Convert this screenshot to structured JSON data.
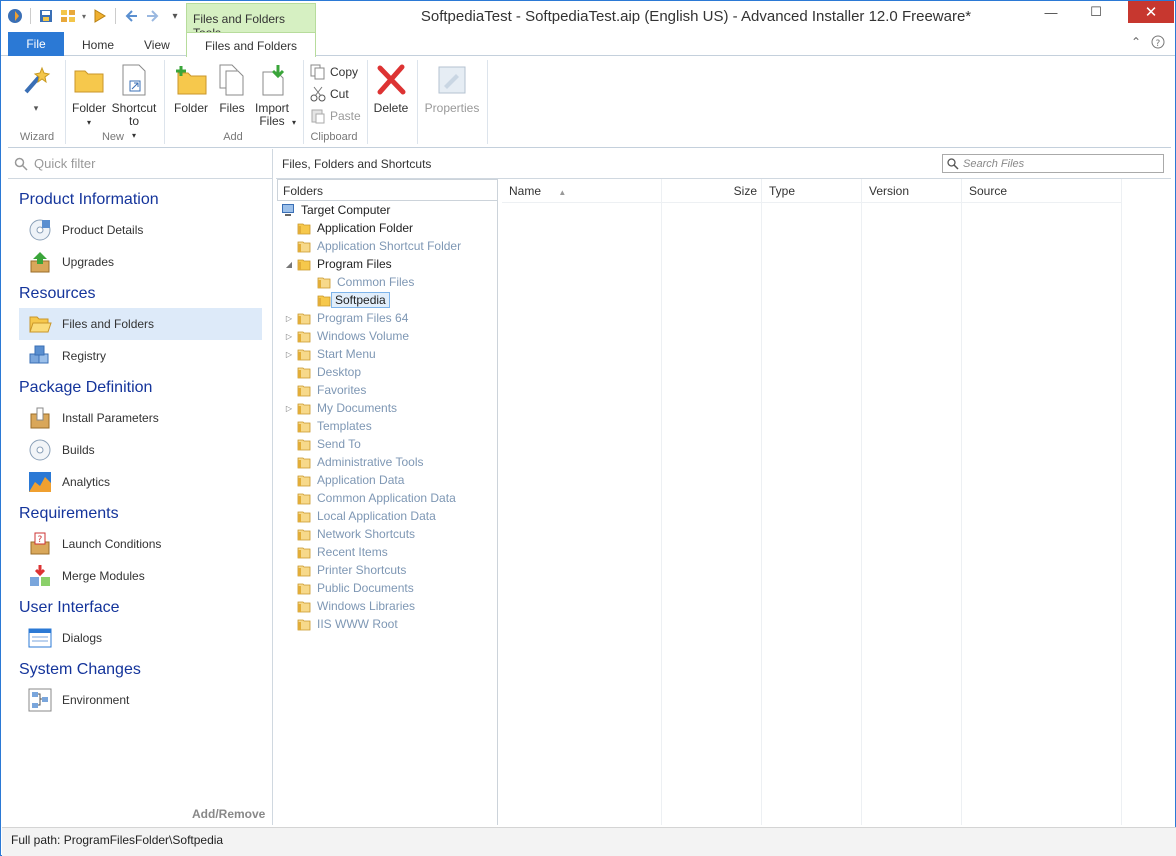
{
  "window": {
    "title": "SoftpediaTest - SoftpediaTest.aip (English US) - Advanced Installer 12.0 Freeware*",
    "context_tab": "Files and Folders Tools",
    "minimize": "—",
    "maximize": "☐",
    "close": "✕"
  },
  "tabs": {
    "file": "File",
    "home": "Home",
    "view": "View",
    "files_and_folders": "Files and Folders"
  },
  "ribbon": {
    "wizard_group": "Wizard",
    "new_group": "New",
    "add_group": "Add",
    "clipboard_group": "Clipboard",
    "folder_new": "Folder",
    "shortcut_to": "Shortcut to",
    "folder_add": "Folder",
    "files": "Files",
    "import_files": "Import Files",
    "copy": "Copy",
    "cut": "Cut",
    "paste": "Paste",
    "delete": "Delete",
    "properties": "Properties"
  },
  "sidebar": {
    "quick_filter_placeholder": "Quick filter",
    "add_remove": "Add/Remove",
    "categories": [
      "Product Information",
      "Resources",
      "Package Definition",
      "Requirements",
      "User Interface",
      "System Changes"
    ],
    "items": [
      "Product Details",
      "Upgrades",
      "Files and Folders",
      "Registry",
      "Install Parameters",
      "Builds",
      "Analytics",
      "Launch Conditions",
      "Merge Modules",
      "Dialogs",
      "Environment"
    ],
    "selected_item": "Files and Folders"
  },
  "main": {
    "title": "Files, Folders and Shortcuts",
    "search_placeholder": "Search Files",
    "folders_header": "Folders",
    "tree": [
      "Target Computer",
      "Application Folder",
      "Application Shortcut Folder",
      "Program Files",
      "Common Files",
      "Softpedia",
      "Program Files 64",
      "Windows Volume",
      "Start Menu",
      "Desktop",
      "Favorites",
      "My Documents",
      "Templates",
      "Send To",
      "Administrative Tools",
      "Application Data",
      "Common Application Data",
      "Local Application Data",
      "Network Shortcuts",
      "Recent Items",
      "Printer Shortcuts",
      "Public Documents",
      "Windows Libraries",
      "IIS WWW Root"
    ],
    "columns": [
      "Name",
      "Size",
      "Type",
      "Version",
      "Source"
    ]
  },
  "status": {
    "full_path": "Full path: ProgramFilesFolder\\Softpedia"
  },
  "colors": {
    "accent": "#2b79d5",
    "category": "#14349b",
    "context_tab": "#d6f0c2",
    "close": "#c7372f"
  }
}
